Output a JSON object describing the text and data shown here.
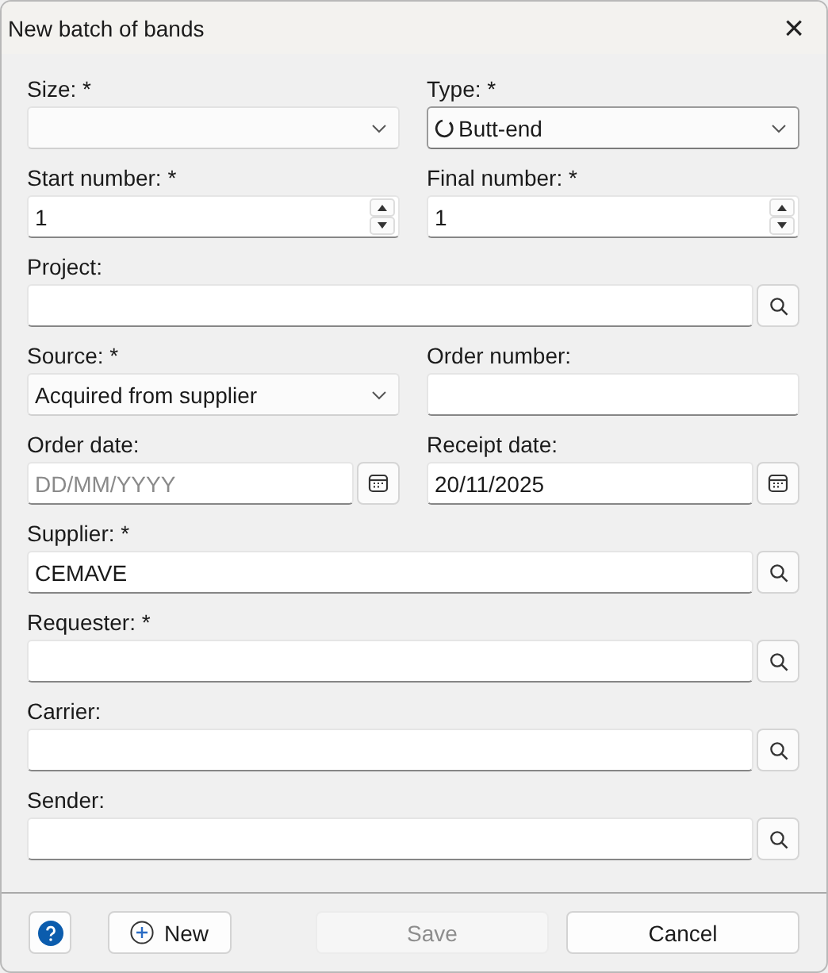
{
  "window": {
    "title": "New batch of bands",
    "close": "×"
  },
  "rows": [
    [
      {
        "kind": "combo",
        "label": "Size: *"
      },
      {
        "kind": "iconcombo",
        "label": "Type: *",
        "value": "Butt-end"
      }
    ],
    [
      {
        "kind": "spin",
        "label": "Start number: *",
        "value": "1"
      },
      {
        "kind": "spin",
        "label": "Final number: *",
        "value": "1"
      }
    ],
    [
      {
        "kind": "lookup",
        "label": "Project:"
      }
    ],
    [
      {
        "kind": "combo",
        "label": "Source: *",
        "value": "Acquired from supplier"
      },
      {
        "kind": "text",
        "label": "Order number:"
      }
    ],
    [
      {
        "kind": "date",
        "label": "Order date:",
        "placeholder": "DD/MM/YYYY"
      },
      {
        "kind": "date",
        "label": "Receipt date:",
        "value": "20/11/2025"
      }
    ],
    [
      {
        "kind": "lookup",
        "label": "Supplier: *",
        "value": "CEMAVE"
      }
    ],
    [
      {
        "kind": "lookup",
        "label": "Requester: *"
      }
    ],
    [
      {
        "kind": "lookup",
        "label": "Carrier:"
      }
    ],
    [
      {
        "kind": "lookup",
        "label": "Sender:"
      }
    ]
  ],
  "footer": {
    "buttons": [
      {
        "kind": "help",
        "disabled": false
      },
      {
        "kind": "new",
        "label": "New",
        "disabled": false
      },
      {
        "kind": "save",
        "label": "Save",
        "disabled": true
      },
      {
        "kind": "cancel",
        "label": "Cancel",
        "disabled": false
      }
    ]
  }
}
